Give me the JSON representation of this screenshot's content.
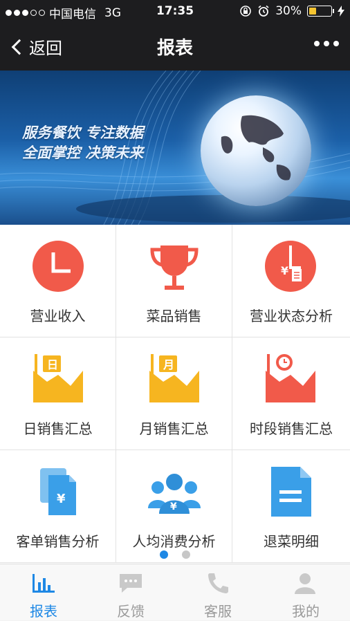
{
  "status_bar": {
    "carrier": "中国电信",
    "network": "3G",
    "time": "17:35",
    "battery": "30%"
  },
  "nav": {
    "back_label": "返回",
    "title": "报表"
  },
  "banner": {
    "line1": "服务餐饮  专注数据",
    "line2": "全面掌控  决策未来"
  },
  "grid": {
    "items": [
      {
        "label": "营业收入",
        "icon": "pie-chart-icon",
        "color": "#f15a4a"
      },
      {
        "label": "菜品销售",
        "icon": "trophy-icon",
        "color": "#f15a4a"
      },
      {
        "label": "营业状态分析",
        "icon": "yuan-clock-icon",
        "color": "#f15a4a"
      },
      {
        "label": "日销售汇总",
        "icon": "daily-chart-icon",
        "badge": "日",
        "color": "#f6b520"
      },
      {
        "label": "月销售汇总",
        "icon": "monthly-chart-icon",
        "badge": "月",
        "color": "#f6b520"
      },
      {
        "label": "时段销售汇总",
        "icon": "time-chart-icon",
        "color": "#f15a4a"
      },
      {
        "label": "客单销售分析",
        "icon": "yuan-document-icon",
        "color": "#3a9fe8"
      },
      {
        "label": "人均消费分析",
        "icon": "group-yuan-icon",
        "color": "#3a9fe8"
      },
      {
        "label": "退菜明细",
        "icon": "document-icon",
        "color": "#3a9fe8"
      }
    ]
  },
  "tabbar": {
    "tabs": [
      {
        "label": "报表",
        "icon": "bar-chart-icon",
        "active": true
      },
      {
        "label": "反馈",
        "icon": "message-icon",
        "active": false
      },
      {
        "label": "客服",
        "icon": "phone-icon",
        "active": false
      },
      {
        "label": "我的",
        "icon": "user-icon",
        "active": false
      }
    ]
  },
  "colors": {
    "accent": "#1e88e5",
    "red": "#f15a4a",
    "yellow": "#f6b520",
    "blue": "#3a9fe8"
  }
}
